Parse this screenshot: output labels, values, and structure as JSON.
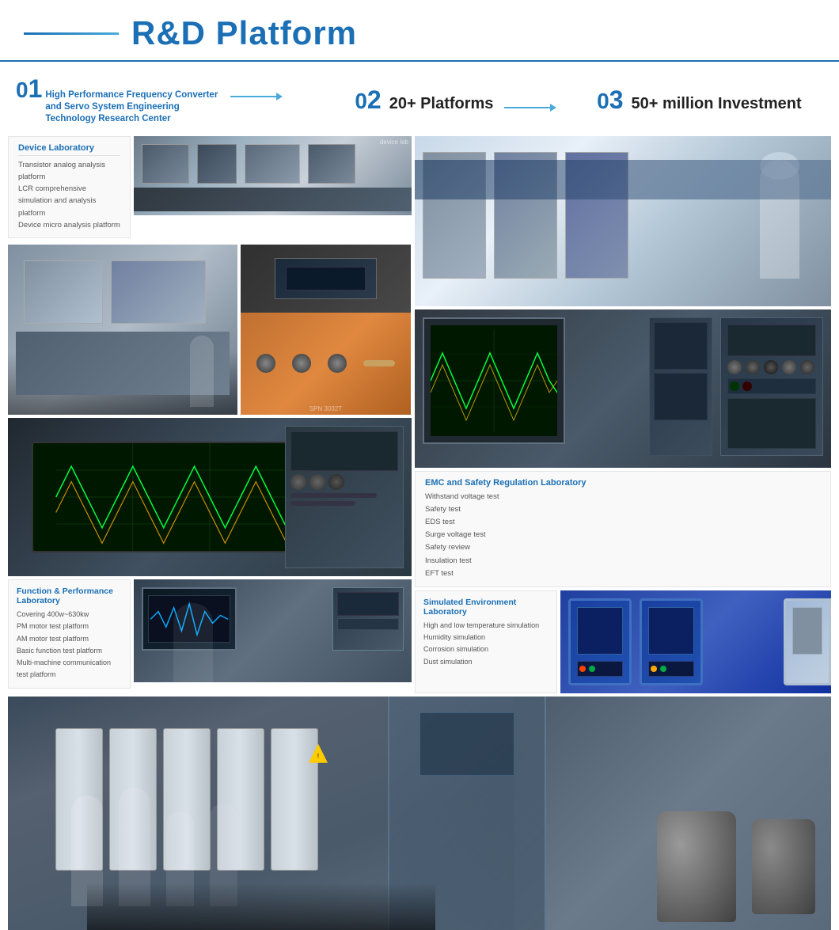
{
  "header": {
    "title": "R&D Platform",
    "line_decoration": true
  },
  "sections": [
    {
      "num": "01",
      "label": "High Performance Frequency Converter and Servo System Engineering Technology Research Center",
      "arrow": true
    },
    {
      "num": "02",
      "label": "20+ Platforms",
      "arrow": true
    },
    {
      "num": "03",
      "label": "50+ million Investment",
      "arrow": false
    }
  ],
  "device_lab": {
    "title": "Device Laboratory",
    "items": [
      "Transistor analog analysis platform",
      "LCR comprehensive simulation and analysis platform",
      "Device micro analysis platform"
    ]
  },
  "emc_lab": {
    "title": "EMC and Safety Regulation Laboratory",
    "items": [
      "Withstand voltage test",
      "Safety test",
      "EDS test",
      "Surge voltage test",
      "Safety review",
      "Insulation test",
      "EFT test"
    ]
  },
  "func_lab": {
    "title": "Function & Performance Laboratory",
    "items": [
      "Covering 400w~630kw",
      "PM motor test platform",
      "AM motor test platform",
      "Basic function test platform",
      "Multi-machine communication test platform"
    ]
  },
  "sim_env_lab": {
    "title": "Simulated Environment Laboratory",
    "items": [
      "High and low temperature simulation",
      "Humidity simulation",
      "Corrosion simulation",
      "Dust simulation"
    ]
  }
}
